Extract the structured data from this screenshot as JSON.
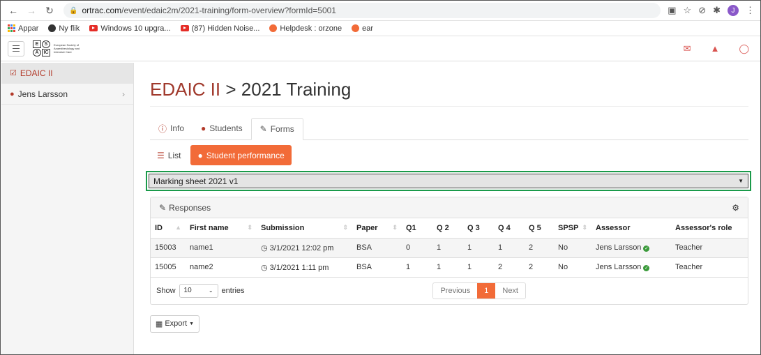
{
  "browser": {
    "url_domain": "ortrac.com",
    "url_path": "/event/edaic2m/2021-training/form-overview?formId=5001",
    "profile_initial": "J"
  },
  "bookmarks": [
    {
      "label": "Appar"
    },
    {
      "label": "Ny flik"
    },
    {
      "label": "Windows 10 upgra..."
    },
    {
      "label": "(87) Hidden Noise..."
    },
    {
      "label": "Helpdesk : orzone"
    },
    {
      "label": "ear"
    }
  ],
  "logo": {
    "letters": [
      "E",
      "S",
      "A",
      "IC"
    ],
    "text": "European Society of Anaesthesiology and Intensive Care"
  },
  "sidebar": {
    "items": [
      {
        "label": "EDAIC II"
      },
      {
        "label": "Jens Larsson"
      }
    ]
  },
  "main": {
    "title_org": "EDAIC II",
    "title_sep": " > ",
    "title_page": "2021 Training",
    "tabs": [
      {
        "label": "Info"
      },
      {
        "label": "Students"
      },
      {
        "label": "Forms"
      }
    ],
    "pills": [
      {
        "label": "List"
      },
      {
        "label": "Student performance"
      }
    ],
    "select_value": "Marking sheet 2021 v1",
    "panel_title": "Responses",
    "columns": [
      "ID",
      "First name",
      "Submission",
      "Paper",
      "Q1",
      "Q 2",
      "Q 3",
      "Q 4",
      "Q 5",
      "SPSP",
      "Assessor",
      "Assessor's role"
    ],
    "rows": [
      [
        "15003",
        "name1",
        "3/1/2021 12:02 pm",
        "BSA",
        "0",
        "1",
        "1",
        "1",
        "2",
        "No",
        "Jens Larsson",
        "Teacher"
      ],
      [
        "15005",
        "name2",
        "3/1/2021 1:11 pm",
        "BSA",
        "1",
        "1",
        "1",
        "2",
        "2",
        "No",
        "Jens Larsson",
        "Teacher"
      ]
    ],
    "show_label": "Show",
    "entries_value": "10",
    "entries_label": "entries",
    "pagination": {
      "previous": "Previous",
      "current": "1",
      "next": "Next"
    },
    "export_label": "Export"
  }
}
